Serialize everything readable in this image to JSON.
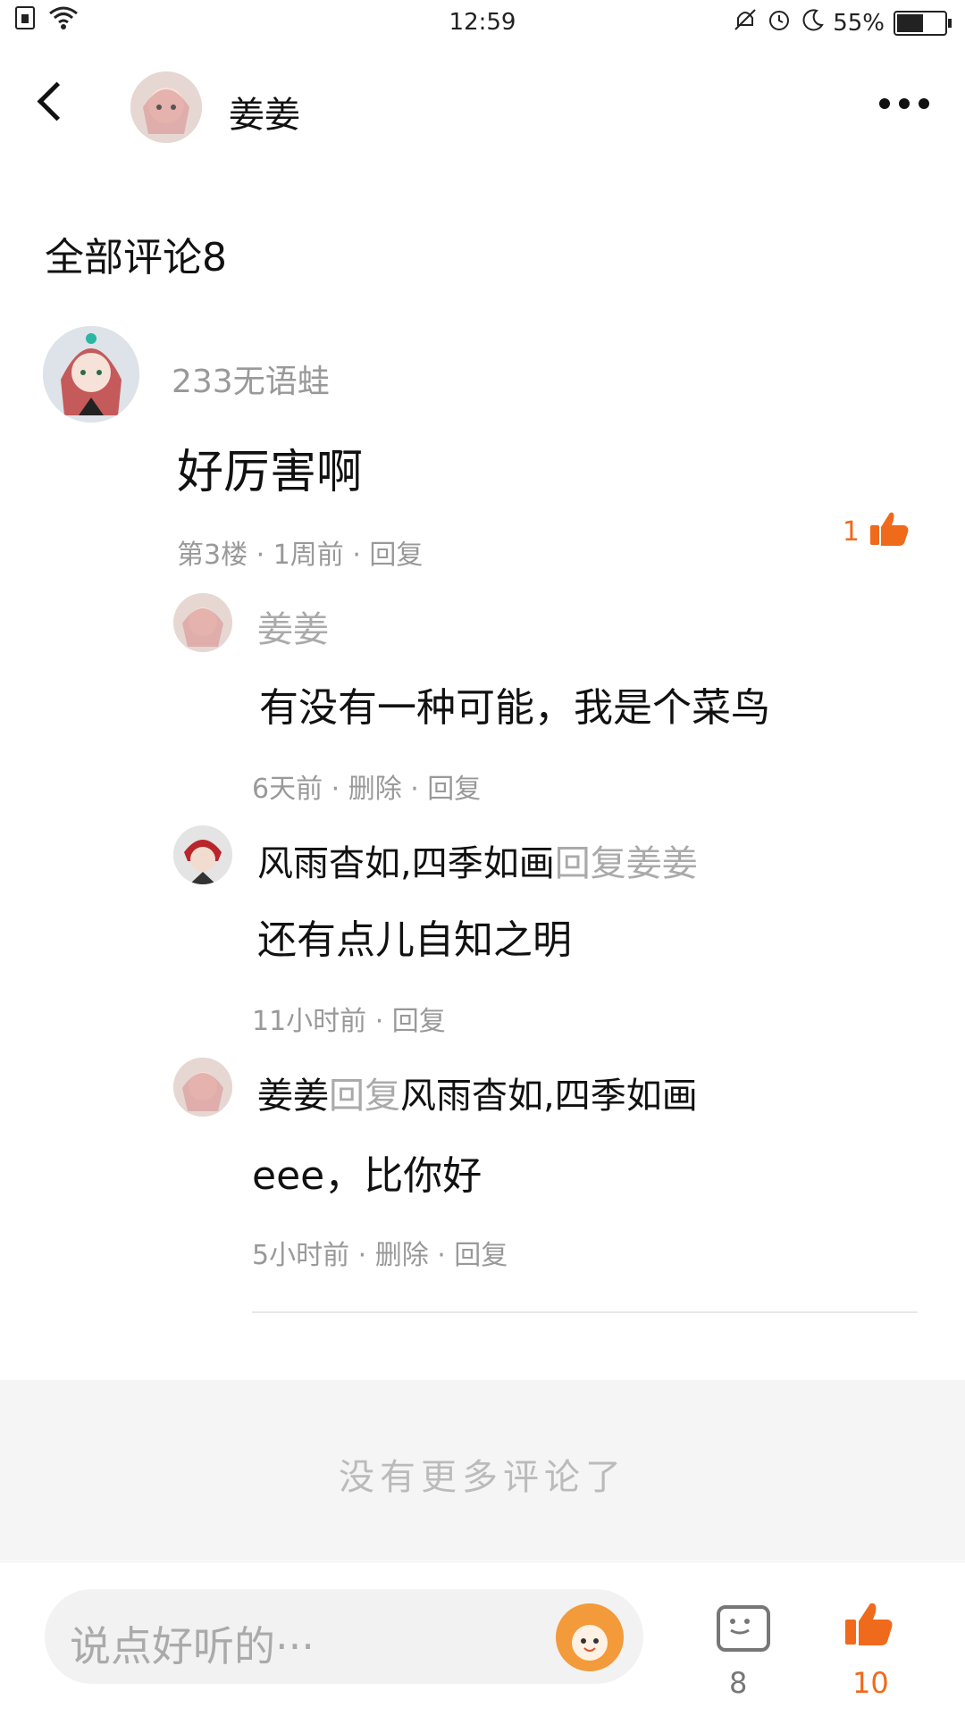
{
  "status_bar": {
    "time": "12:59",
    "battery": "55%",
    "battery_level": 0.55
  },
  "header": {
    "user_name": "姜姜"
  },
  "section_title": "全部评论8",
  "comment": {
    "author": "233无语蛙",
    "text": "好厉害啊",
    "meta": "第3楼 · 1周前 · 回复",
    "likes": "1"
  },
  "replies": [
    {
      "author": "姜姜",
      "reply_word": "",
      "reply_to": "",
      "text": "有没有一种可能，我是个菜鸟",
      "meta": "6天前 · 删除 · 回复"
    },
    {
      "author": "风雨杳如,四季如画",
      "reply_word": "回复",
      "reply_to": "姜姜",
      "text": "还有点儿自知之明",
      "meta": "11小时前 · 回复"
    },
    {
      "author": "姜姜",
      "reply_word": "回复",
      "reply_to": "风雨杳如,四季如画",
      "text": "eee，比你好",
      "meta": "5小时前 · 删除 · 回复"
    }
  ],
  "no_more": "没有更多评论了",
  "bottom_bar": {
    "input_placeholder": "说点好听的···",
    "comment_count": "8",
    "like_count": "10"
  },
  "colors": {
    "accent": "#f06a1c",
    "muted": "#999999"
  }
}
